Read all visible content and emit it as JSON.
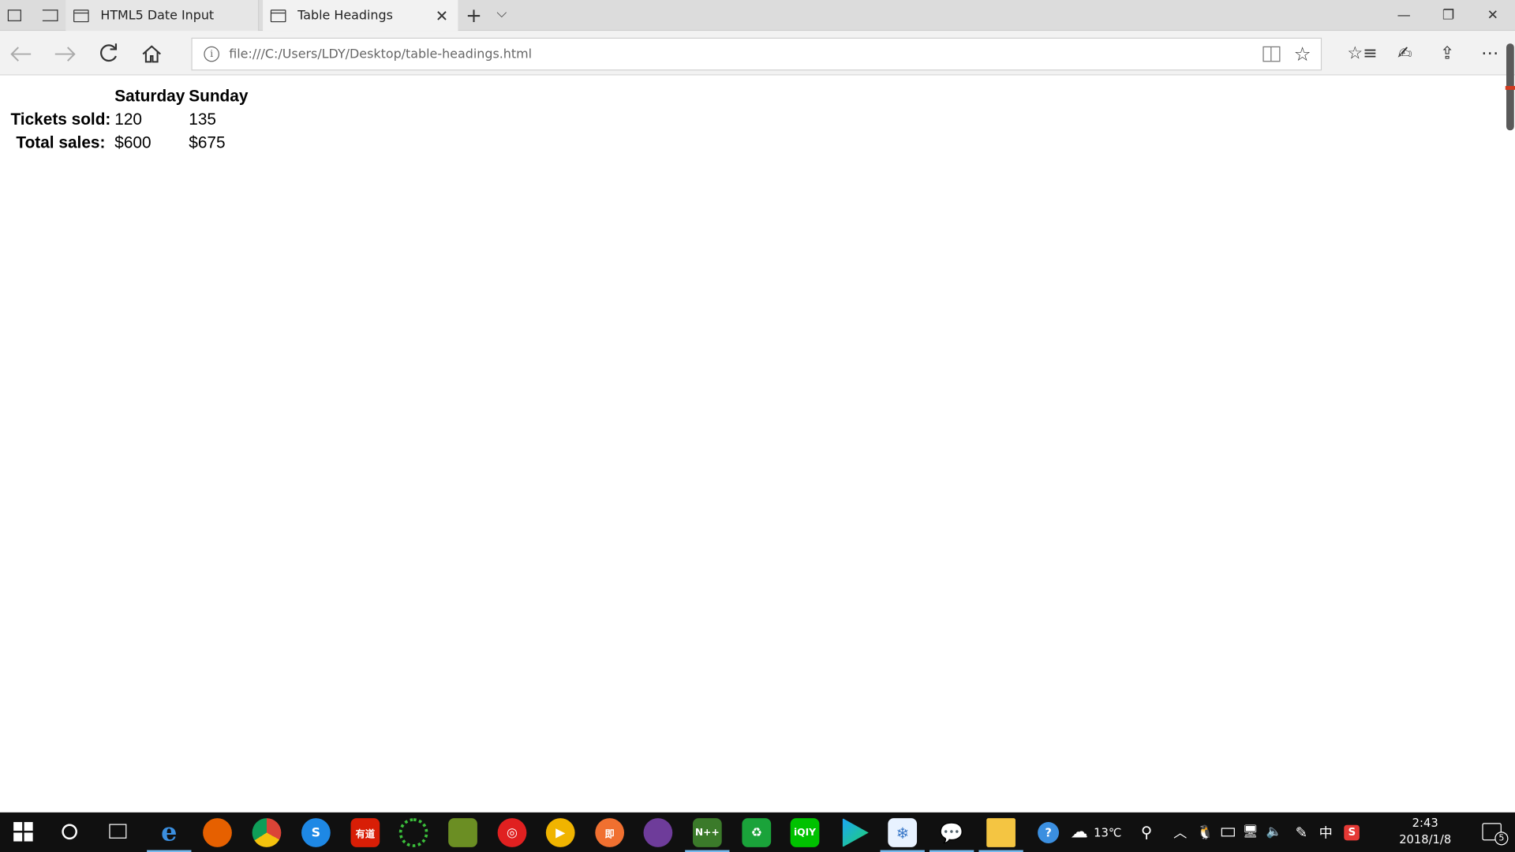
{
  "browser": {
    "tabs": [
      {
        "label": "HTML5 Date Input"
      },
      {
        "label": "Table Headings"
      }
    ],
    "url": "file:///C:/Users/LDY/Desktop/table-headings.html"
  },
  "page": {
    "headers": [
      "",
      "Saturday",
      "Sunday"
    ],
    "rows": [
      {
        "label": "Tickets sold:",
        "values": [
          "120",
          "135"
        ]
      },
      {
        "label": "Total sales:",
        "values": [
          "$600",
          "$675"
        ]
      }
    ]
  },
  "taskbar": {
    "weather": "13℃",
    "ime": "中",
    "time": "2:43",
    "date": "2018/1/8",
    "notifications": "5"
  }
}
